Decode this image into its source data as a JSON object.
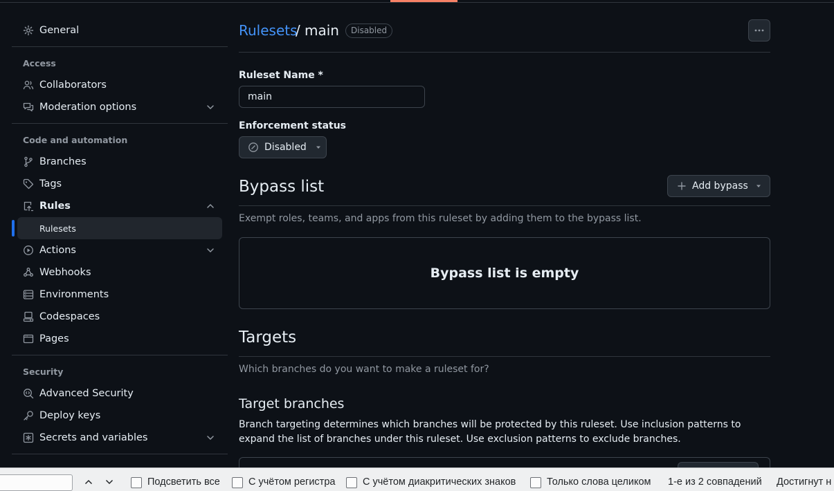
{
  "sidebar": {
    "general": "General",
    "access_title": "Access",
    "collaborators": "Collaborators",
    "moderation": "Moderation options",
    "code_title": "Code and automation",
    "branches": "Branches",
    "tags": "Tags",
    "rules": "Rules",
    "rulesets": "Rulesets",
    "actions": "Actions",
    "webhooks": "Webhooks",
    "environments": "Environments",
    "codespaces": "Codespaces",
    "pages": "Pages",
    "security_title": "Security",
    "advanced_security": "Advanced Security",
    "deploy_keys": "Deploy keys",
    "secrets": "Secrets and variables"
  },
  "header": {
    "crumb": "Rulesets",
    "sep": "/",
    "name": "main",
    "badge": "Disabled"
  },
  "form": {
    "name_label": "Ruleset Name *",
    "name_value": "main",
    "enforcement_label": "Enforcement status",
    "enforcement_value": "Disabled"
  },
  "bypass": {
    "title": "Bypass list",
    "add_label": "Add bypass",
    "description": "Exempt roles, teams, and apps from this ruleset by adding them to the bypass list.",
    "empty": "Bypass list is empty"
  },
  "targets": {
    "title": "Targets",
    "description": "Which branches do you want to make a ruleset for?",
    "branches_title": "Target branches",
    "branches_description": "Branch targeting determines which branches will be protected by this ruleset. Use inclusion patterns to expand the list of branches under this ruleset. Use exclusion patterns to exclude branches."
  },
  "findbar": {
    "highlight_all": "Подсветить все",
    "match_case": "С учётом регистра",
    "diacritics": "С учётом диакритических знаков",
    "whole_words": "Только слова целиком",
    "matches": "1-е из 2 совпадений",
    "reached": "Достигнут н"
  },
  "colors": {
    "accent": "#4493f8",
    "background": "#0d1117",
    "border": "#30363d",
    "selected_indicator": "#1f6feb"
  }
}
